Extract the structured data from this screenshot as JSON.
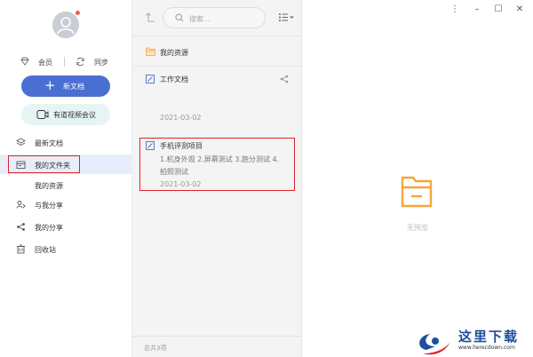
{
  "sidebar": {
    "vip_label": "会员",
    "sync_label": "同步",
    "new_doc_label": "新文档",
    "meeting_label": "有道视频会议",
    "nav": [
      {
        "label": "最新文档",
        "icon": "layers-icon"
      },
      {
        "label": "我的文件夹",
        "icon": "folder-icon"
      },
      {
        "label": "我的资源",
        "icon": ""
      },
      {
        "label": "与我分享",
        "icon": "shared-with-me-icon"
      },
      {
        "label": "我的分享",
        "icon": "share-icon"
      },
      {
        "label": "回收站",
        "icon": "trash-icon"
      }
    ]
  },
  "list": {
    "search_placeholder": "搜索...",
    "folder_item": "我的资源",
    "docs": [
      {
        "title": "工作文档",
        "snippet": "",
        "date": "2021-03-02"
      },
      {
        "title": "手机评测项目",
        "snippet": "1.机身外观 2.屏幕测试 3.跑分测试 4.拍照测试",
        "date": "2021-03-02"
      }
    ],
    "footer": "总共3项"
  },
  "preview": {
    "empty_text": "无预览",
    "window_controls": [
      "⋮",
      "–",
      "☐",
      "✕"
    ]
  },
  "watermark": {
    "text": "这里下载",
    "url": "www.herecdown.com"
  },
  "colors": {
    "accent": "#4a6fd2",
    "highlight_red": "#e3232a",
    "folder_orange": "#f3a73c"
  }
}
